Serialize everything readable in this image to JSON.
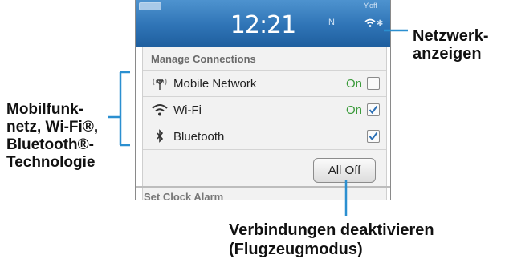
{
  "status_bar": {
    "time": "12:21",
    "network_indicator": "N",
    "signal_text": "Ƴoff",
    "icons": [
      "battery-icon",
      "wifi-signal-icon",
      "bluetooth-icon"
    ]
  },
  "manage_connections": {
    "header": "Manage Connections",
    "rows": [
      {
        "label": "Mobile Network",
        "state": "On",
        "checked": false,
        "icon": "antenna-icon"
      },
      {
        "label": "Wi-Fi",
        "state": "On",
        "checked": true,
        "icon": "wifi-icon"
      },
      {
        "label": "Bluetooth",
        "state": "",
        "checked": true,
        "icon": "bluetooth-icon"
      }
    ],
    "all_off_button": "All Off",
    "next_item_partial": "Set Clock Alarm"
  },
  "callouts": {
    "network_indicators": [
      "Netzwerk-",
      "anzeigen"
    ],
    "connections": [
      "Mobilfunk-",
      "netz, Wi-Fi®,",
      "Bluetooth®-",
      "Technologie"
    ],
    "deactivate": [
      "Verbindungen deaktivieren",
      "(Flugzeugmodus)"
    ]
  },
  "colors": {
    "status_bar": "#2f74b6",
    "callout_line": "#2b8fd0",
    "state_on": "#3a9a3a",
    "checkmark": "#2b6fb5"
  }
}
